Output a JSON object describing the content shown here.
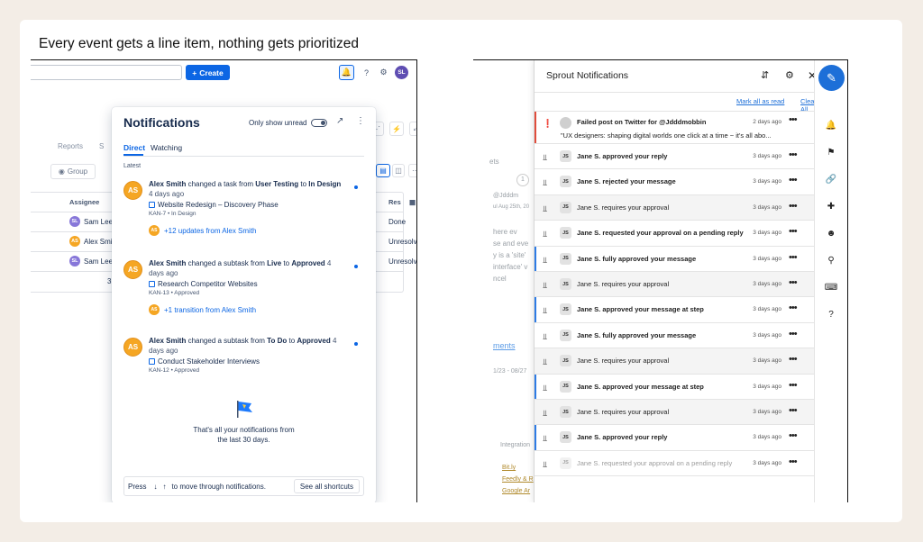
{
  "heading": "Every event gets a line item, nothing gets prioritized",
  "jira": {
    "create_label": "Create",
    "avatar_initials": "SL",
    "bg_tabs": [
      "Reports",
      "S"
    ],
    "group_label": "Group",
    "columns": {
      "assignee": "Assignee",
      "res": "Res"
    },
    "rows": [
      {
        "initials": "SL",
        "name": "Sam Lee",
        "status": "Done",
        "color": "#8777d9"
      },
      {
        "initials": "AS",
        "name": "Alex Smi",
        "status": "Unresolved",
        "color": "#f5a623"
      },
      {
        "initials": "SL",
        "name": "Sam Lee",
        "status": "Unresolved",
        "color": "#8777d9"
      }
    ],
    "row_count_partial": "3",
    "notifications": {
      "title": "Notifications",
      "only_unread": "Only show unread",
      "tabs": [
        "Direct",
        "Watching"
      ],
      "section": "Latest",
      "items": [
        {
          "initials": "AS",
          "actor": "Alex Smith",
          "action": " changed a task from ",
          "from": "User Testing",
          "to_word": " to ",
          "to": "In Design",
          "age": " 4 days ago",
          "subject": "Website Redesign – Discovery Phase",
          "meta": "KAN-7 • In Design",
          "more": "+12 updates from Alex Smith"
        },
        {
          "initials": "AS",
          "actor": "Alex Smith",
          "action": " changed a subtask from ",
          "from": "Live",
          "to_word": " to ",
          "to": "Approved",
          "age": " 4 days ago",
          "subject": "Research Competitor Websites",
          "meta": "KAN-13 • Approved",
          "more": "+1 transition from Alex Smith"
        },
        {
          "initials": "AS",
          "actor": "Alex Smith",
          "action": " changed a subtask from ",
          "from": "To Do",
          "to_word": " to ",
          "to": "Approved",
          "age": " 4 days ago",
          "subject": "Conduct Stakeholder Interviews",
          "meta": "KAN-12 • Approved"
        }
      ],
      "end_message_1": "That's all your notifications from",
      "end_message_2": "the last 30 days.",
      "footer_press": "Press",
      "footer_text": "to move through notifications.",
      "footer_button": "See all shortcuts"
    }
  },
  "sprout": {
    "title": "Sprout Notifications",
    "mark_all_read": "Mark all as read",
    "clear_all": "Clear All",
    "bg_fragments": [
      "ets",
      "@Jdddm",
      "ul Aug 25th, 20",
      "here ev",
      "se and eve",
      "y is a 'site'",
      "interface' v",
      "ncel",
      "ments",
      "1/23 - 08/27",
      "Integration",
      "Bit.ly",
      "Feedly & R",
      "Google Ar"
    ],
    "rows": [
      {
        "type": "alert",
        "bar": "red",
        "text": "Failed post on Twitter for @Jdddmobbin",
        "sub": "\"UX designers: shaping digital worlds one click at a time ~ it's all abo...",
        "time": "2 days ago",
        "grey": false
      },
      {
        "type": "stamp",
        "bar": "",
        "text": "Jane S. approved your reply",
        "bold": true,
        "time": "3 days ago",
        "grey": false
      },
      {
        "type": "stamp",
        "bar": "",
        "text": "Jane S. rejected your message",
        "bold": true,
        "time": "3 days ago",
        "grey": false
      },
      {
        "type": "stamp",
        "bar": "",
        "text": "Jane S. requires your approval",
        "bold": false,
        "time": "3 days ago",
        "grey": true
      },
      {
        "type": "stamp",
        "bar": "",
        "text": "Jane S. requested your approval on a pending reply",
        "bold": true,
        "time": "3 days ago",
        "grey": false
      },
      {
        "type": "stamp",
        "bar": "blue",
        "text": "Jane S. fully approved your message",
        "bold": true,
        "time": "3 days ago",
        "grey": false
      },
      {
        "type": "stamp",
        "bar": "",
        "text": "Jane S. requires your approval",
        "bold": false,
        "time": "3 days ago",
        "grey": true
      },
      {
        "type": "stamp",
        "bar": "blue",
        "text": "Jane S. approved your message at step",
        "bold": true,
        "time": "3 days ago",
        "grey": false
      },
      {
        "type": "stamp",
        "bar": "",
        "text": "Jane S. fully approved your message",
        "bold": true,
        "time": "3 days ago",
        "grey": false
      },
      {
        "type": "stamp",
        "bar": "",
        "text": "Jane S. requires your approval",
        "bold": false,
        "time": "3 days ago",
        "grey": true
      },
      {
        "type": "stamp",
        "bar": "blue",
        "text": "Jane S. approved your message at step",
        "bold": true,
        "time": "3 days ago",
        "grey": false
      },
      {
        "type": "stamp",
        "bar": "",
        "text": "Jane S. requires your approval",
        "bold": false,
        "time": "3 days ago",
        "grey": true
      },
      {
        "type": "stamp",
        "bar": "blue",
        "text": "Jane S. approved your reply",
        "bold": true,
        "time": "3 days ago",
        "grey": false
      },
      {
        "type": "stamp",
        "bar": "",
        "text": "Jane S. requested your approval on a pending reply",
        "bold": false,
        "time": "3 days ago",
        "grey": false,
        "faded": true
      }
    ],
    "row_initials": "JS",
    "colors": {
      "accent": "#1d6fd8",
      "alert_bar": "#e04c3c",
      "unread_bar": "#2d7be5"
    }
  }
}
